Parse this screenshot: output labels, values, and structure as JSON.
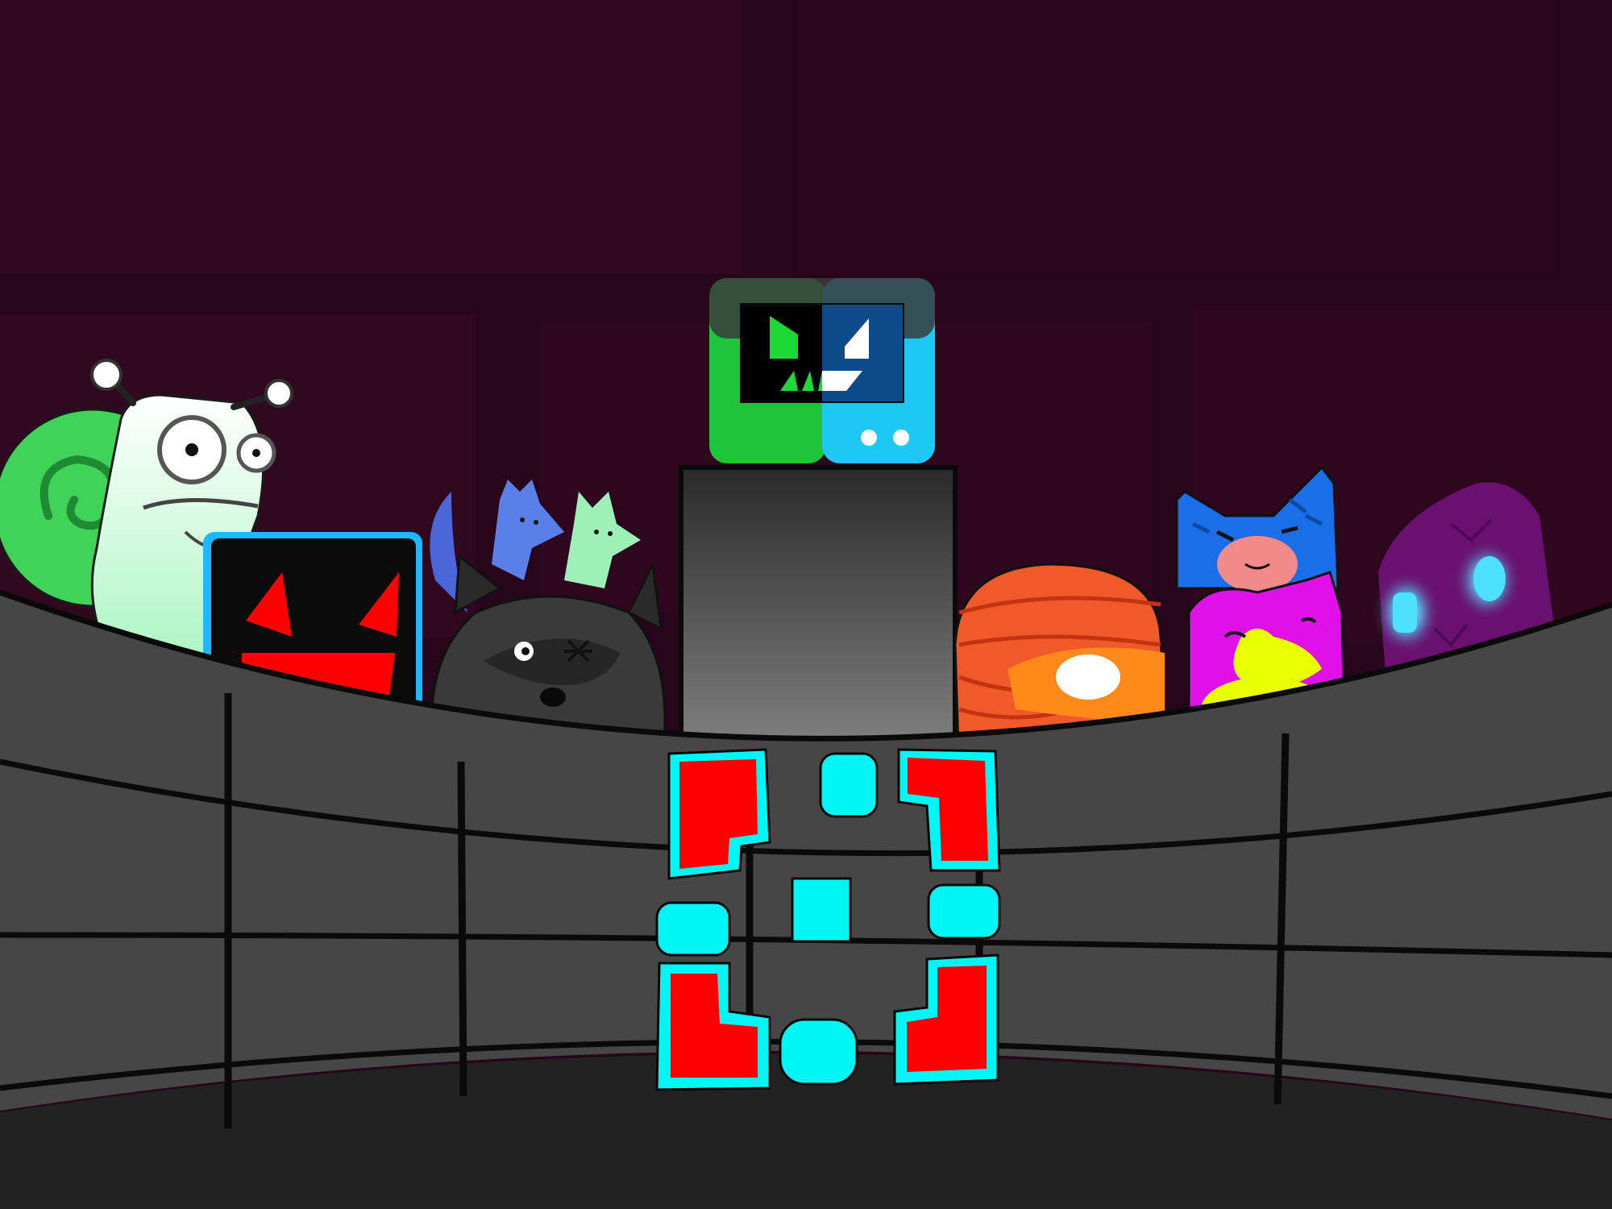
{
  "colors": {
    "background": "#2a0516",
    "wall_panel": "#33091f",
    "floor": "#232323",
    "arena_wall": "#454545",
    "outline": "#0a0a0a",
    "monitor_green": "#1ec43a",
    "monitor_blue": "#1ec8f5",
    "cube_red": "#ff0000",
    "cube_cyan": "#00f5f5",
    "cyan_glow": "#4de0ff"
  },
  "characters": [
    {
      "id": "snail",
      "icon": "snail-with-green-shell",
      "colors": [
        "#e8fff0",
        "#3fd35a"
      ]
    },
    {
      "id": "red-angry-cube",
      "icon": "black-cube-red-angry-face",
      "colors": [
        "#0b0b0b",
        "#ff0000",
        "#1eb8ff"
      ]
    },
    {
      "id": "fox-trio",
      "icon": "three-small-foxes",
      "colors": [
        "#5a7fe8",
        "#9cf0b8",
        "#4a66d8"
      ]
    },
    {
      "id": "raccoon",
      "icon": "grey-raccoon-with-scar",
      "colors": [
        "#2c2c2c",
        "#3e3e3e"
      ]
    },
    {
      "id": "monitor-head",
      "icon": "monitor-face-split-green-blue",
      "colors": [
        "#1ec43a",
        "#1ec8f5"
      ]
    },
    {
      "id": "mummy",
      "icon": "orange-bandaged-mummy",
      "colors": [
        "#f05a2a",
        "#ff8a1a"
      ]
    },
    {
      "id": "cat-stack",
      "icon": "blue-cat-and-pink-cat",
      "colors": [
        "#1a6fe8",
        "#e010e8",
        "#e8ff00"
      ]
    },
    {
      "id": "ghost",
      "icon": "purple-ghost-glowing-eyes",
      "colors": [
        "#6a1070",
        "#4de0ff"
      ]
    },
    {
      "id": "cube-player",
      "icon": "segmented-red-cyan-cube",
      "colors": [
        "#ff0000",
        "#00f5f5"
      ]
    }
  ]
}
